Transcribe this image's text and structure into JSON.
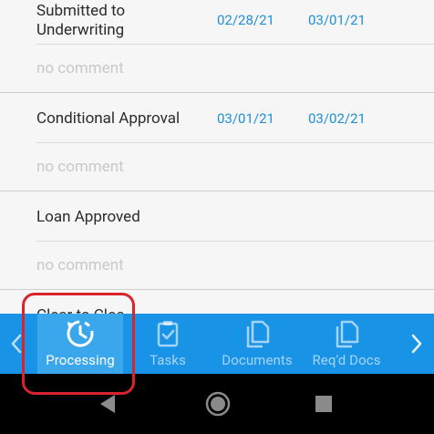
{
  "milestones": [
    {
      "title_line1": "Submitted to",
      "title_line2": "Underwriting",
      "date1": "02/28/21",
      "date2": "03/01/21",
      "comment": "no comment"
    },
    {
      "title_line1": "Conditional Approval",
      "date1": "03/01/21",
      "date2": "03/02/21",
      "comment": "no comment"
    },
    {
      "title_line1": "Loan Approved",
      "comment": "no comment"
    },
    {
      "title_line1": "Clear to Clos"
    }
  ],
  "tabs": {
    "processing": "Processing",
    "tasks": "Tasks",
    "documents": "Documents",
    "reqd_docs": "Req'd Docs"
  },
  "colors": {
    "accent": "#1993e6",
    "active_tab": "#3aa6ec",
    "date_text": "#1f8fd8",
    "highlight": "#d9232d"
  },
  "icons": {
    "left_arrow": "chevron-left-icon",
    "right_arrow": "chevron-right-icon",
    "processing": "clock-icon",
    "tasks": "clipboard-check-icon",
    "documents": "documents-icon",
    "reqd_docs": "required-documents-icon",
    "back": "back-icon",
    "home": "home-icon",
    "recents": "recents-icon"
  }
}
